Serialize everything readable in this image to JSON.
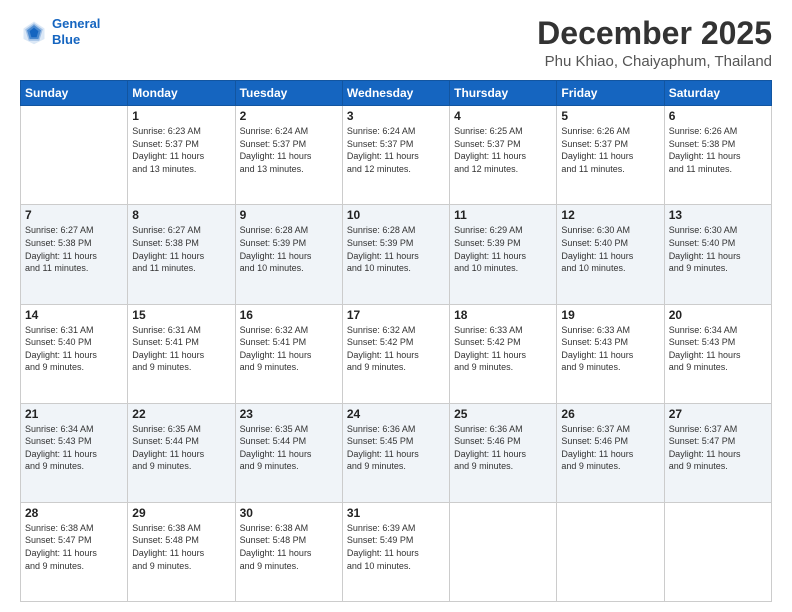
{
  "header": {
    "logo_line1": "General",
    "logo_line2": "Blue",
    "title": "December 2025",
    "subtitle": "Phu Khiao, Chaiyaphum, Thailand"
  },
  "calendar": {
    "days_of_week": [
      "Sunday",
      "Monday",
      "Tuesday",
      "Wednesday",
      "Thursday",
      "Friday",
      "Saturday"
    ],
    "weeks": [
      [
        {
          "day": "",
          "info": ""
        },
        {
          "day": "1",
          "info": "Sunrise: 6:23 AM\nSunset: 5:37 PM\nDaylight: 11 hours\nand 13 minutes."
        },
        {
          "day": "2",
          "info": "Sunrise: 6:24 AM\nSunset: 5:37 PM\nDaylight: 11 hours\nand 13 minutes."
        },
        {
          "day": "3",
          "info": "Sunrise: 6:24 AM\nSunset: 5:37 PM\nDaylight: 11 hours\nand 12 minutes."
        },
        {
          "day": "4",
          "info": "Sunrise: 6:25 AM\nSunset: 5:37 PM\nDaylight: 11 hours\nand 12 minutes."
        },
        {
          "day": "5",
          "info": "Sunrise: 6:26 AM\nSunset: 5:37 PM\nDaylight: 11 hours\nand 11 minutes."
        },
        {
          "day": "6",
          "info": "Sunrise: 6:26 AM\nSunset: 5:38 PM\nDaylight: 11 hours\nand 11 minutes."
        }
      ],
      [
        {
          "day": "7",
          "info": "Sunrise: 6:27 AM\nSunset: 5:38 PM\nDaylight: 11 hours\nand 11 minutes."
        },
        {
          "day": "8",
          "info": "Sunrise: 6:27 AM\nSunset: 5:38 PM\nDaylight: 11 hours\nand 11 minutes."
        },
        {
          "day": "9",
          "info": "Sunrise: 6:28 AM\nSunset: 5:39 PM\nDaylight: 11 hours\nand 10 minutes."
        },
        {
          "day": "10",
          "info": "Sunrise: 6:28 AM\nSunset: 5:39 PM\nDaylight: 11 hours\nand 10 minutes."
        },
        {
          "day": "11",
          "info": "Sunrise: 6:29 AM\nSunset: 5:39 PM\nDaylight: 11 hours\nand 10 minutes."
        },
        {
          "day": "12",
          "info": "Sunrise: 6:30 AM\nSunset: 5:40 PM\nDaylight: 11 hours\nand 10 minutes."
        },
        {
          "day": "13",
          "info": "Sunrise: 6:30 AM\nSunset: 5:40 PM\nDaylight: 11 hours\nand 9 minutes."
        }
      ],
      [
        {
          "day": "14",
          "info": "Sunrise: 6:31 AM\nSunset: 5:40 PM\nDaylight: 11 hours\nand 9 minutes."
        },
        {
          "day": "15",
          "info": "Sunrise: 6:31 AM\nSunset: 5:41 PM\nDaylight: 11 hours\nand 9 minutes."
        },
        {
          "day": "16",
          "info": "Sunrise: 6:32 AM\nSunset: 5:41 PM\nDaylight: 11 hours\nand 9 minutes."
        },
        {
          "day": "17",
          "info": "Sunrise: 6:32 AM\nSunset: 5:42 PM\nDaylight: 11 hours\nand 9 minutes."
        },
        {
          "day": "18",
          "info": "Sunrise: 6:33 AM\nSunset: 5:42 PM\nDaylight: 11 hours\nand 9 minutes."
        },
        {
          "day": "19",
          "info": "Sunrise: 6:33 AM\nSunset: 5:43 PM\nDaylight: 11 hours\nand 9 minutes."
        },
        {
          "day": "20",
          "info": "Sunrise: 6:34 AM\nSunset: 5:43 PM\nDaylight: 11 hours\nand 9 minutes."
        }
      ],
      [
        {
          "day": "21",
          "info": "Sunrise: 6:34 AM\nSunset: 5:43 PM\nDaylight: 11 hours\nand 9 minutes."
        },
        {
          "day": "22",
          "info": "Sunrise: 6:35 AM\nSunset: 5:44 PM\nDaylight: 11 hours\nand 9 minutes."
        },
        {
          "day": "23",
          "info": "Sunrise: 6:35 AM\nSunset: 5:44 PM\nDaylight: 11 hours\nand 9 minutes."
        },
        {
          "day": "24",
          "info": "Sunrise: 6:36 AM\nSunset: 5:45 PM\nDaylight: 11 hours\nand 9 minutes."
        },
        {
          "day": "25",
          "info": "Sunrise: 6:36 AM\nSunset: 5:46 PM\nDaylight: 11 hours\nand 9 minutes."
        },
        {
          "day": "26",
          "info": "Sunrise: 6:37 AM\nSunset: 5:46 PM\nDaylight: 11 hours\nand 9 minutes."
        },
        {
          "day": "27",
          "info": "Sunrise: 6:37 AM\nSunset: 5:47 PM\nDaylight: 11 hours\nand 9 minutes."
        }
      ],
      [
        {
          "day": "28",
          "info": "Sunrise: 6:38 AM\nSunset: 5:47 PM\nDaylight: 11 hours\nand 9 minutes."
        },
        {
          "day": "29",
          "info": "Sunrise: 6:38 AM\nSunset: 5:48 PM\nDaylight: 11 hours\nand 9 minutes."
        },
        {
          "day": "30",
          "info": "Sunrise: 6:38 AM\nSunset: 5:48 PM\nDaylight: 11 hours\nand 9 minutes."
        },
        {
          "day": "31",
          "info": "Sunrise: 6:39 AM\nSunset: 5:49 PM\nDaylight: 11 hours\nand 10 minutes."
        },
        {
          "day": "",
          "info": ""
        },
        {
          "day": "",
          "info": ""
        },
        {
          "day": "",
          "info": ""
        }
      ]
    ]
  }
}
